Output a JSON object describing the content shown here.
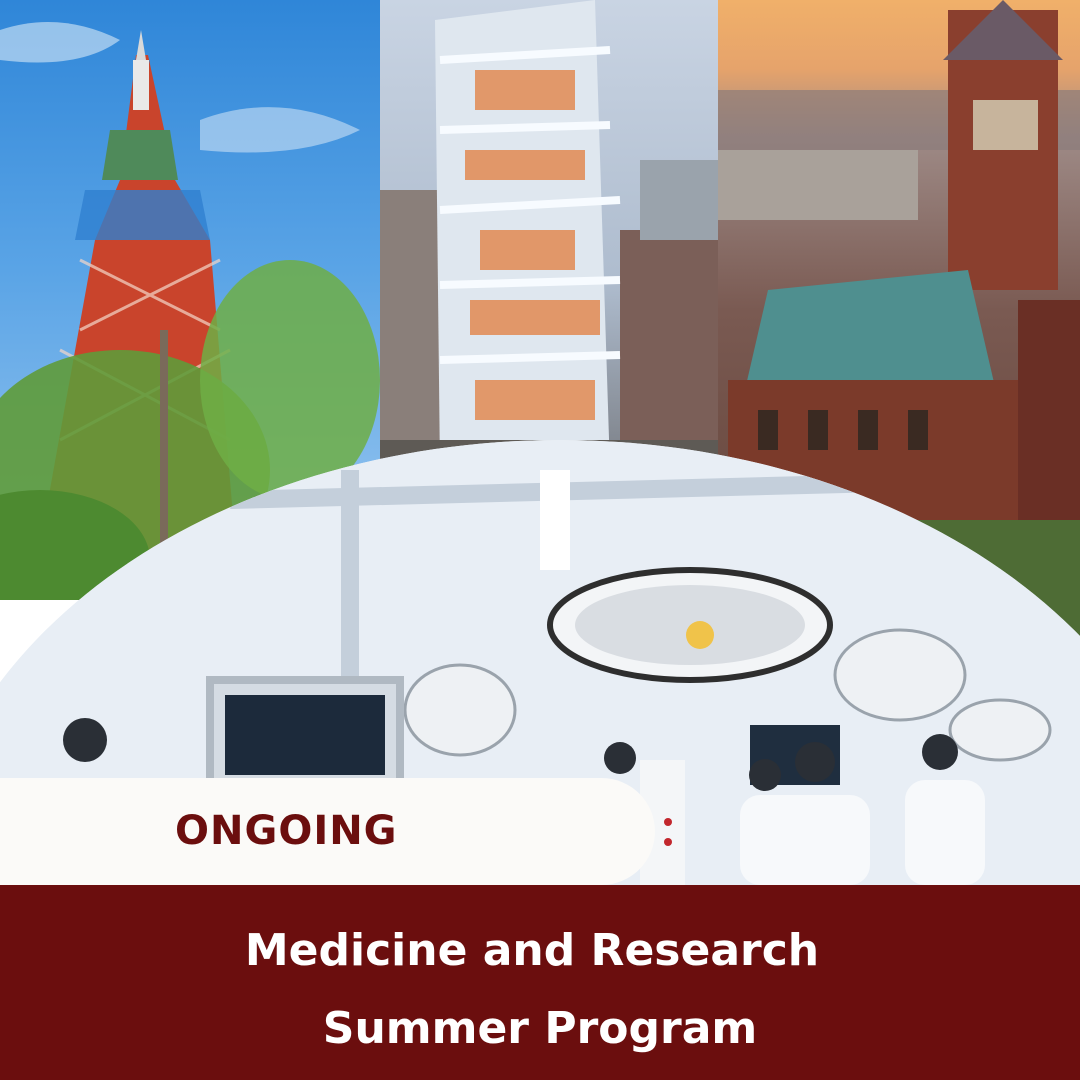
{
  "badge": {
    "label": "ONGOING"
  },
  "footer": {
    "line1": "Medicine and Research",
    "line2": "Summer Program"
  },
  "colors": {
    "brand_maroon": "#6b0e0e",
    "ribbon_bg": "#fbfaf8",
    "title_text": "#ffffff"
  },
  "photos": [
    {
      "icon": "tokyo-tower-photo"
    },
    {
      "icon": "glass-tower-photo"
    },
    {
      "icon": "campus-hall-photo"
    },
    {
      "icon": "operating-room-photo"
    }
  ]
}
